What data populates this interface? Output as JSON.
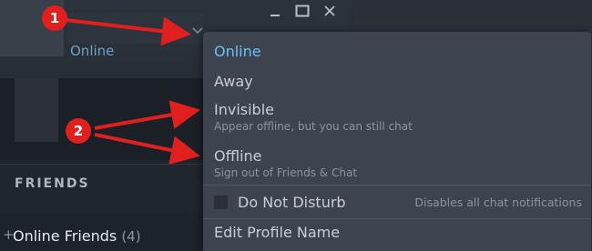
{
  "profile": {
    "status": "Online"
  },
  "window_controls": {
    "minimize_icon": "minimize-icon",
    "maximize_icon": "maximize-icon",
    "close_icon": "close-icon"
  },
  "friends": {
    "header": "FRIENDS",
    "online_friends_label": "Online Friends",
    "online_friends_count": "(4)"
  },
  "status_menu": {
    "online": "Online",
    "away": "Away",
    "invisible": "Invisible",
    "invisible_desc": "Appear offline, but you can still chat",
    "offline": "Offline",
    "offline_desc": "Sign out of Friends & Chat",
    "dnd": "Do Not Disturb",
    "dnd_desc": "Disables all chat notifications",
    "edit_profile": "Edit Profile Name"
  },
  "annotations": {
    "marker1": "1",
    "marker2": "2"
  },
  "colors": {
    "accent_online": "#67c1f5",
    "annotation_red": "#e0201e",
    "menu_bg": "#3d4450"
  }
}
